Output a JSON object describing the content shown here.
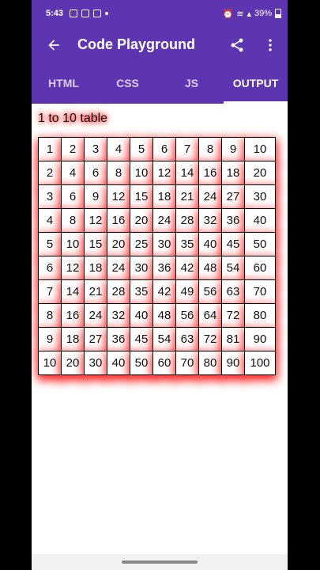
{
  "status": {
    "time": "5:43",
    "battery": "39%"
  },
  "appbar": {
    "title": "Code Playground",
    "back_icon": "arrow-back-icon",
    "share_icon": "share-icon",
    "menu_icon": "more-vert-icon"
  },
  "tabs": [
    {
      "label": "HTML"
    },
    {
      "label": "CSS"
    },
    {
      "label": "JS"
    },
    {
      "label": "OUTPUT"
    }
  ],
  "active_tab": "OUTPUT",
  "output": {
    "heading": "1 to 10 table",
    "rows": [
      [
        "1",
        "2",
        "3",
        "4",
        "5",
        "6",
        "7",
        "8",
        "9",
        "10"
      ],
      [
        "2",
        "4",
        "6",
        "8",
        "10",
        "12",
        "14",
        "16",
        "18",
        "20"
      ],
      [
        "3",
        "6",
        "9",
        "12",
        "15",
        "18",
        "21",
        "24",
        "27",
        "30"
      ],
      [
        "4",
        "8",
        "12",
        "16",
        "20",
        "24",
        "28",
        "32",
        "36",
        "40"
      ],
      [
        "5",
        "10",
        "15",
        "20",
        "25",
        "30",
        "35",
        "40",
        "45",
        "50"
      ],
      [
        "6",
        "12",
        "18",
        "24",
        "30",
        "36",
        "42",
        "48",
        "54",
        "60"
      ],
      [
        "7",
        "14",
        "21",
        "28",
        "35",
        "42",
        "49",
        "56",
        "63",
        "70"
      ],
      [
        "8",
        "16",
        "24",
        "32",
        "40",
        "48",
        "56",
        "64",
        "72",
        "80"
      ],
      [
        "9",
        "18",
        "27",
        "36",
        "45",
        "54",
        "63",
        "72",
        "81",
        "90"
      ],
      [
        "10",
        "20",
        "30",
        "40",
        "50",
        "60",
        "70",
        "80",
        "90",
        "100"
      ]
    ]
  },
  "colors": {
    "primary": "#5e35b1",
    "glow": "#ff0000"
  }
}
